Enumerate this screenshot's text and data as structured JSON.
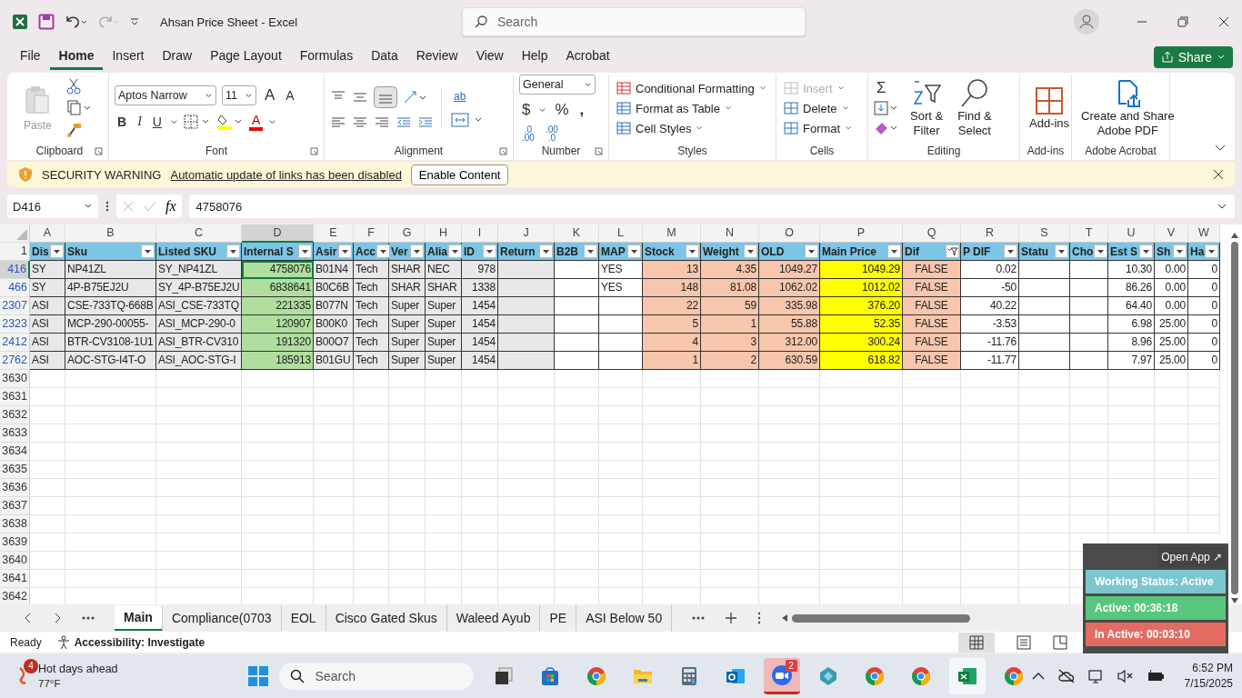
{
  "title_bar": {
    "title": "Ahsan Price Sheet  -  Excel",
    "search_placeholder": "Search"
  },
  "menu_tabs": [
    {
      "label": "File",
      "selected": false
    },
    {
      "label": "Home",
      "selected": true
    },
    {
      "label": "Insert",
      "selected": false
    },
    {
      "label": "Draw",
      "selected": false
    },
    {
      "label": "Page Layout",
      "selected": false
    },
    {
      "label": "Formulas",
      "selected": false
    },
    {
      "label": "Data",
      "selected": false
    },
    {
      "label": "Review",
      "selected": false
    },
    {
      "label": "View",
      "selected": false
    },
    {
      "label": "Help",
      "selected": false
    },
    {
      "label": "Acrobat",
      "selected": false
    }
  ],
  "share_button": "Share",
  "ribbon": {
    "clipboard": {
      "paste": "Paste",
      "label": "Clipboard"
    },
    "font": {
      "name": "Aptos Narrow",
      "size": "11",
      "grow": "A",
      "shrink": "A",
      "bold": "B",
      "italic": "I",
      "underline": "U",
      "font_color": "A",
      "label": "Font"
    },
    "alignment": {
      "wrap": "ab",
      "label": "Alignment"
    },
    "number": {
      "format": "General",
      "currency": "$",
      "percent": "%",
      "comma": ",",
      "increase_decimal": [
        ".0",
        ".00"
      ],
      "decrease_decimal": [
        ".00",
        ".0"
      ],
      "label": "Number"
    },
    "styles": {
      "items": [
        "Conditional Formatting",
        "Format as Table",
        "Cell Styles"
      ],
      "label": "Styles"
    },
    "cells": {
      "items": [
        {
          "label": "Insert",
          "disabled": true
        },
        {
          "label": "Delete",
          "disabled": false
        },
        {
          "label": "Format",
          "disabled": false
        }
      ],
      "label": "Cells"
    },
    "editing": {
      "sum": "Σ",
      "items": [
        [
          "Sort &",
          "Filter"
        ],
        [
          "Find &",
          "Select"
        ]
      ],
      "label": "Editing"
    },
    "addins": {
      "button": "Add-ins",
      "label": "Add-ins"
    },
    "acrobat": {
      "button": [
        "Create and Share",
        "Adobe PDF"
      ],
      "label": "Adobe Acrobat"
    }
  },
  "security_bar": {
    "title": "SECURITY WARNING",
    "message": "Automatic update of links has been disabled",
    "button": "Enable Content"
  },
  "formula_bar": {
    "name_box": "D416",
    "fx": "fx",
    "formula": "4758076"
  },
  "sheet": {
    "columns": [
      {
        "letter": "A",
        "header": "Dis",
        "kind": "text",
        "color": "#e8e8e8",
        "selected": false,
        "filtered": false
      },
      {
        "letter": "B",
        "header": "Sku",
        "kind": "text",
        "color": "#e8e8e8",
        "selected": false,
        "filtered": false
      },
      {
        "letter": "C",
        "header": "Listed SKU",
        "kind": "text",
        "color": "#e8e8e8",
        "selected": false,
        "filtered": false
      },
      {
        "letter": "D",
        "header": "Internal S",
        "kind": "number",
        "color": "#b0de9f",
        "selected": true,
        "filtered": false
      },
      {
        "letter": "E",
        "header": "Asir",
        "kind": "text",
        "color": "#e8e8e8",
        "selected": false,
        "filtered": false
      },
      {
        "letter": "F",
        "header": "Acc",
        "kind": "text",
        "color": "#e8e8e8",
        "selected": false,
        "filtered": false
      },
      {
        "letter": "G",
        "header": "Ver",
        "kind": "text",
        "color": "#e8e8e8",
        "selected": false,
        "filtered": false
      },
      {
        "letter": "H",
        "header": "Alia",
        "kind": "text",
        "color": "#e8e8e8",
        "selected": false,
        "filtered": false
      },
      {
        "letter": "I",
        "header": "ID",
        "kind": "number",
        "color": "#e8e8e8",
        "selected": false,
        "filtered": false
      },
      {
        "letter": "J",
        "header": "Return",
        "kind": "text",
        "color": "#e8e8e8",
        "selected": false,
        "filtered": false
      },
      {
        "letter": "K",
        "header": "B2B",
        "kind": "text",
        "color": "#ffffff",
        "selected": false,
        "filtered": false
      },
      {
        "letter": "L",
        "header": "MAP",
        "kind": "text",
        "color": "#ffffff",
        "selected": false,
        "filtered": false
      },
      {
        "letter": "M",
        "header": "Stock",
        "kind": "number",
        "color": "#f7c6ac",
        "selected": false,
        "filtered": false
      },
      {
        "letter": "N",
        "header": "Weight",
        "kind": "number",
        "color": "#f7c6ac",
        "selected": false,
        "filtered": false
      },
      {
        "letter": "O",
        "header": "OLD",
        "kind": "number",
        "color": "#f7c6ac",
        "selected": false,
        "filtered": false
      },
      {
        "letter": "P",
        "header": "Main Price",
        "kind": "number",
        "color": "#ffff00",
        "selected": false,
        "filtered": false
      },
      {
        "letter": "Q",
        "header": "Dif",
        "kind": "center",
        "color": "#f7c6ac",
        "selected": false,
        "filtered": true
      },
      {
        "letter": "R",
        "header": "P DIF",
        "kind": "number",
        "color": "#ffffff",
        "selected": false,
        "filtered": false
      },
      {
        "letter": "S",
        "header": "Statu",
        "kind": "text",
        "color": "#ffffff",
        "selected": false,
        "filtered": false
      },
      {
        "letter": "T",
        "header": "Cho",
        "kind": "text",
        "color": "#ffffff",
        "selected": false,
        "filtered": false
      },
      {
        "letter": "U",
        "header": "Est S",
        "kind": "number",
        "color": "#ffffff",
        "selected": false,
        "filtered": false
      },
      {
        "letter": "V",
        "header": "Sh",
        "kind": "number",
        "color": "#ffffff",
        "selected": false,
        "filtered": false
      },
      {
        "letter": "W",
        "header": "Ha",
        "kind": "number",
        "color": "#ffffff",
        "selected": false,
        "filtered": false
      }
    ],
    "header_row": "1",
    "rows": [
      {
        "number": "416",
        "selected": true,
        "cells": [
          "SY",
          "NP41ZL",
          "SY_NP41ZL",
          "4758076",
          "B01N4",
          "Tech",
          "SHAR",
          "NEC",
          "978",
          null,
          null,
          "YES",
          "13",
          "4.35",
          "1049.27",
          "1049.29",
          "FALSE",
          "0.02",
          null,
          null,
          "10.30",
          "0.00",
          "0"
        ]
      },
      {
        "number": "466",
        "selected": false,
        "cells": [
          "SY",
          "4P-B75EJ2U",
          "SY_4P-B75EJ2U",
          "6838641",
          "B0C6B",
          "Tech",
          "SHAR",
          "SHAR",
          "1338",
          null,
          null,
          "YES",
          "148",
          "81.08",
          "1062.02",
          "1012.02",
          "FALSE",
          "-50",
          null,
          null,
          "86.26",
          "0.00",
          "0"
        ]
      },
      {
        "number": "2307",
        "selected": false,
        "cells": [
          "ASI",
          "CSE-733TQ-668B",
          "ASI_CSE-733TQ",
          "221335",
          "B077N",
          "Tech",
          "Super",
          "Super",
          "1454",
          null,
          null,
          null,
          "22",
          "59",
          "335.98",
          "376.20",
          "FALSE",
          "40.22",
          null,
          null,
          "64.40",
          "0.00",
          "0"
        ]
      },
      {
        "number": "2323",
        "selected": false,
        "cells": [
          "ASI",
          "MCP-290-00055-",
          "ASI_MCP-290-0",
          "120907",
          "B00K0",
          "Tech",
          "Super",
          "Super",
          "1454",
          null,
          null,
          null,
          "5",
          "1",
          "55.88",
          "52.35",
          "FALSE",
          "-3.53",
          null,
          null,
          "6.98",
          "25.00",
          "0"
        ]
      },
      {
        "number": "2412",
        "selected": false,
        "cells": [
          "ASI",
          "BTR-CV3108-1U1",
          "ASI_BTR-CV310",
          "191320",
          "B00O7",
          "Tech",
          "Super",
          "Super",
          "1454",
          null,
          null,
          null,
          "4",
          "3",
          "312.00",
          "300.24",
          "FALSE",
          "-11.76",
          null,
          null,
          "8.96",
          "25.00",
          "0"
        ]
      },
      {
        "number": "2762",
        "selected": false,
        "cells": [
          "ASI",
          "AOC-STG-I4T-O",
          "ASI_AOC-STG-I",
          "185913",
          "B01GU",
          "Tech",
          "Super",
          "Super",
          "1454",
          null,
          null,
          null,
          "1",
          "2",
          "630.59",
          "618.82",
          "FALSE",
          "-11.77",
          null,
          null,
          "7.97",
          "25.00",
          "0"
        ]
      }
    ],
    "empty_rows": [
      "3630",
      "3631",
      "3632",
      "3633",
      "3634",
      "3635",
      "3636",
      "3637",
      "3638",
      "3639",
      "3640",
      "3641",
      "3642"
    ]
  },
  "sheet_tabs": [
    {
      "label": "Main",
      "selected": true
    },
    {
      "label": "Compliance(0703",
      "selected": false
    },
    {
      "label": "EOL",
      "selected": false
    },
    {
      "label": "Cisco Gated Skus",
      "selected": false
    },
    {
      "label": "Waleed Ayub",
      "selected": false
    },
    {
      "label": "PE",
      "selected": false
    },
    {
      "label": "ASI Below 50",
      "selected": false
    }
  ],
  "status_bar": {
    "status": "Ready",
    "accessibility": "Accessibility: Investigate"
  },
  "tracker": {
    "open_app": "Open App ↗",
    "items": [
      {
        "label": "Working Status: Active",
        "color": "#7cc6d0"
      },
      {
        "label": "Active: 00:36:18",
        "color": "#58c77e"
      },
      {
        "label": "In Active: 00:03:10",
        "color": "#e36c62"
      }
    ]
  },
  "taskbar": {
    "weather": {
      "badge": "4",
      "title": "Hot days ahead",
      "temp": "77°F"
    },
    "search_placeholder": "Search",
    "apps": [
      {
        "kind": "taskview",
        "selected": false
      },
      {
        "kind": "store",
        "selected": false
      },
      {
        "kind": "chrome",
        "selected": false
      },
      {
        "kind": "folder",
        "selected": false
      },
      {
        "kind": "calculator",
        "selected": false
      },
      {
        "kind": "mail",
        "selected": false
      },
      {
        "kind": "zoom",
        "selected": true,
        "badge": "2"
      },
      {
        "kind": "diamond",
        "selected": false
      },
      {
        "kind": "chrome",
        "selected": false
      },
      {
        "kind": "chrome",
        "selected": false
      },
      {
        "kind": "sheets",
        "selected": true
      },
      {
        "kind": "chrome",
        "selected": false
      }
    ],
    "time": "6:52 PM",
    "date": "7/15/2025"
  }
}
